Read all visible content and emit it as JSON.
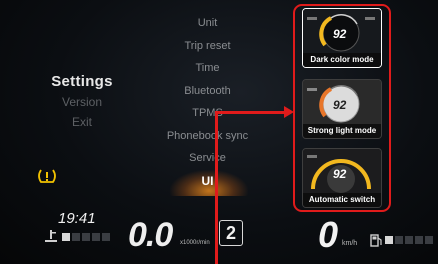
{
  "left_menu": {
    "active": "Settings",
    "items": [
      "Version",
      "Exit"
    ]
  },
  "mid_menu": {
    "items": [
      "Unit",
      "Trip reset",
      "Time",
      "Bluetooth",
      "TPMS",
      "Phonebook sync",
      "Service"
    ],
    "selected": "UI"
  },
  "cards": [
    {
      "label": "Dark color mode",
      "value": "92"
    },
    {
      "label": "Strong light mode",
      "value": "92"
    },
    {
      "label": "Automatic switch",
      "value": "92"
    }
  ],
  "status": {
    "time": "19:41",
    "rpm": "0.0",
    "rpm_unit": "x1000r/min",
    "gear": "2",
    "speed": "0",
    "speed_unit": "km/h"
  },
  "icons": {
    "warning": "tire-pressure-warning-icon",
    "temperature": "coolant-temperature-icon",
    "fuel": "fuel-pump-icon"
  },
  "colors": {
    "highlight": "#e01b1b",
    "accent_orange": "#ff9a2a",
    "warning_yellow": "#f2c200"
  }
}
